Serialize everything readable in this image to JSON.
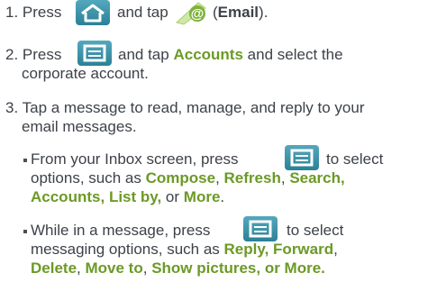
{
  "step1": {
    "number": "1.",
    "press": "Press",
    "and_tap": "and tap",
    "paren_open": "(",
    "email": "Email",
    "paren_close": ")."
  },
  "step2": {
    "number": "2.",
    "press": "Press",
    "and_tap": "and tap",
    "accounts": "Accounts",
    "rest": "and select the",
    "line2": "corporate account."
  },
  "step3": {
    "number": "3.",
    "line1": "Tap a message to read, manage, and reply to your",
    "line2": "email messages.",
    "bullet1": {
      "line1a": "From your Inbox screen, press",
      "line1b": "to select",
      "line2a": "options, such as",
      "compose": "Compose",
      "comma1": ",",
      "refresh": "Refresh",
      "comma2": ",",
      "search": "Search",
      "comma3": ",",
      "accounts": "Accounts",
      "comma4": ",",
      "listby": "List by,",
      "or": "or",
      "more": "More",
      "period": "."
    },
    "bullet2": {
      "line1a": "While in a message, press",
      "line1b": "to select",
      "line2a": "messaging options, such as",
      "reply": "Reply",
      "comma1": ",",
      "forward": "Forward",
      "comma2": ",",
      "delete": "Delete",
      "comma3": ",",
      "moveto": "Move to",
      "comma4": ",",
      "showpics": "Show pictures, or More."
    }
  },
  "icons": {
    "home_key": "home-key-icon",
    "email_app": "email-app-icon",
    "menu_key": "menu-key-icon"
  },
  "colors": {
    "text": "#3d4249",
    "highlight": "#6b9a26",
    "key_teal": "#3594ab"
  }
}
